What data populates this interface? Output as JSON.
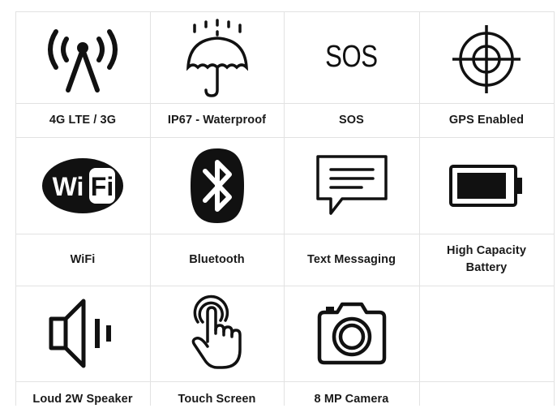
{
  "features": {
    "row1": [
      {
        "label": "4G LTE / 3G",
        "icon": "antenna-signal-icon"
      },
      {
        "label": "IP67 - Waterproof",
        "icon": "umbrella-rain-icon"
      },
      {
        "label": "SOS",
        "icon": "sos-icon",
        "icon_text": "SOS"
      },
      {
        "label": "GPS Enabled",
        "icon": "crosshair-target-icon"
      }
    ],
    "row2": [
      {
        "label": "WiFi",
        "icon": "wifi-logo-icon",
        "icon_text": "WiFi"
      },
      {
        "label": "Bluetooth",
        "icon": "bluetooth-icon"
      },
      {
        "label": "Text Messaging",
        "icon": "message-bubble-icon"
      },
      {
        "label": "High Capacity Battery",
        "icon": "battery-icon"
      }
    ],
    "row3": [
      {
        "label": "Loud 2W Speaker",
        "icon": "speaker-icon"
      },
      {
        "label": "Touch Screen",
        "icon": "touch-hand-icon"
      },
      {
        "label": "8 MP Camera",
        "icon": "camera-icon"
      }
    ]
  },
  "colors": {
    "icon": "#111111",
    "grid_line": "#e2e2e2",
    "label": "#1a1a1a"
  }
}
